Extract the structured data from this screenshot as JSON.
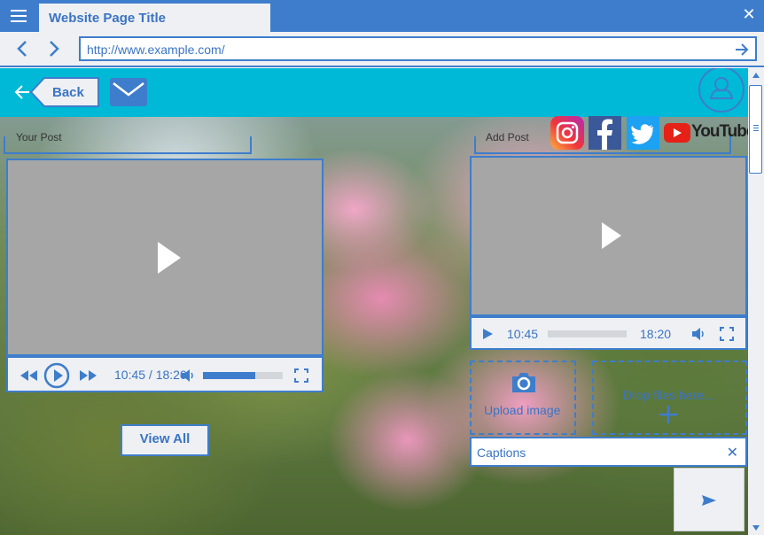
{
  "window": {
    "tab_title": "Website Page Title"
  },
  "address": {
    "url": "http://www.example.com/"
  },
  "header": {
    "back_label": "Back"
  },
  "your_post": {
    "label": "Your Post",
    "time_display": "10:45 / 18:20",
    "volume_level": 0.65,
    "view_all_label": "View All"
  },
  "add_post": {
    "label": "Add Post",
    "current_time": "10:45",
    "duration": "18:20",
    "upload_label": "Upload image",
    "drop_label": "Drop files here...",
    "caption_placeholder": "Captions"
  },
  "social": [
    "instagram-icon",
    "facebook-icon",
    "twitter-icon",
    "youtube-icon"
  ],
  "youtube_text": "YouTube",
  "colors": {
    "accent": "#3e7dcb",
    "header": "#00b9d6",
    "panel": "#eef0f3",
    "video": "#a6a6a6"
  }
}
